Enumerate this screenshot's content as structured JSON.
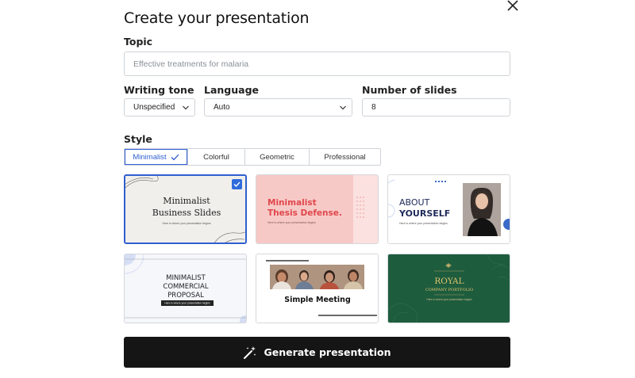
{
  "dialog": {
    "title": "Create your presentation",
    "close_icon": "close-icon"
  },
  "topic": {
    "label": "Topic",
    "placeholder": "Effective treatments for malaria"
  },
  "writing_tone": {
    "label": "Writing tone",
    "value": "Unspecified"
  },
  "language": {
    "label": "Language",
    "value": "Auto"
  },
  "slides": {
    "label": "Number of slides",
    "value": "8"
  },
  "style": {
    "label": "Style",
    "options": [
      "Minimalist",
      "Colorful",
      "Geometric",
      "Professional"
    ],
    "selected": "Minimalist"
  },
  "templates": [
    {
      "line1": "Minimalist",
      "line2": "Business Slides",
      "sub": "Here is where your presentation begins",
      "selected": true
    },
    {
      "line1": "Minimalist",
      "line2": "Thesis Defense.",
      "sub": "Here is where your presentation begins"
    },
    {
      "line1": "ABOUT",
      "line2": "YOURSELF",
      "sub": "Here is where your presentation begins"
    },
    {
      "line1": "MINIMALIST",
      "line2": "COMMERCIAL",
      "line3": "PROPOSAL",
      "sub": "Here is where your presentation begins"
    },
    {
      "line1": "Simple Meeting"
    },
    {
      "line1": "ROYAL",
      "line2": "COMPANY PORTFOLIO",
      "sub": "Here is where your presentation begins"
    }
  ],
  "generate": {
    "label": "Generate presentation",
    "icon": "magic-wand-icon"
  },
  "colors": {
    "accent": "#2f5fd0",
    "button_bg": "#151515",
    "royal_green": "#1e5c3e",
    "thesis_pink": "#f7c9c6",
    "thesis_red": "#e0474c",
    "about_navy": "#1f2a5a"
  }
}
